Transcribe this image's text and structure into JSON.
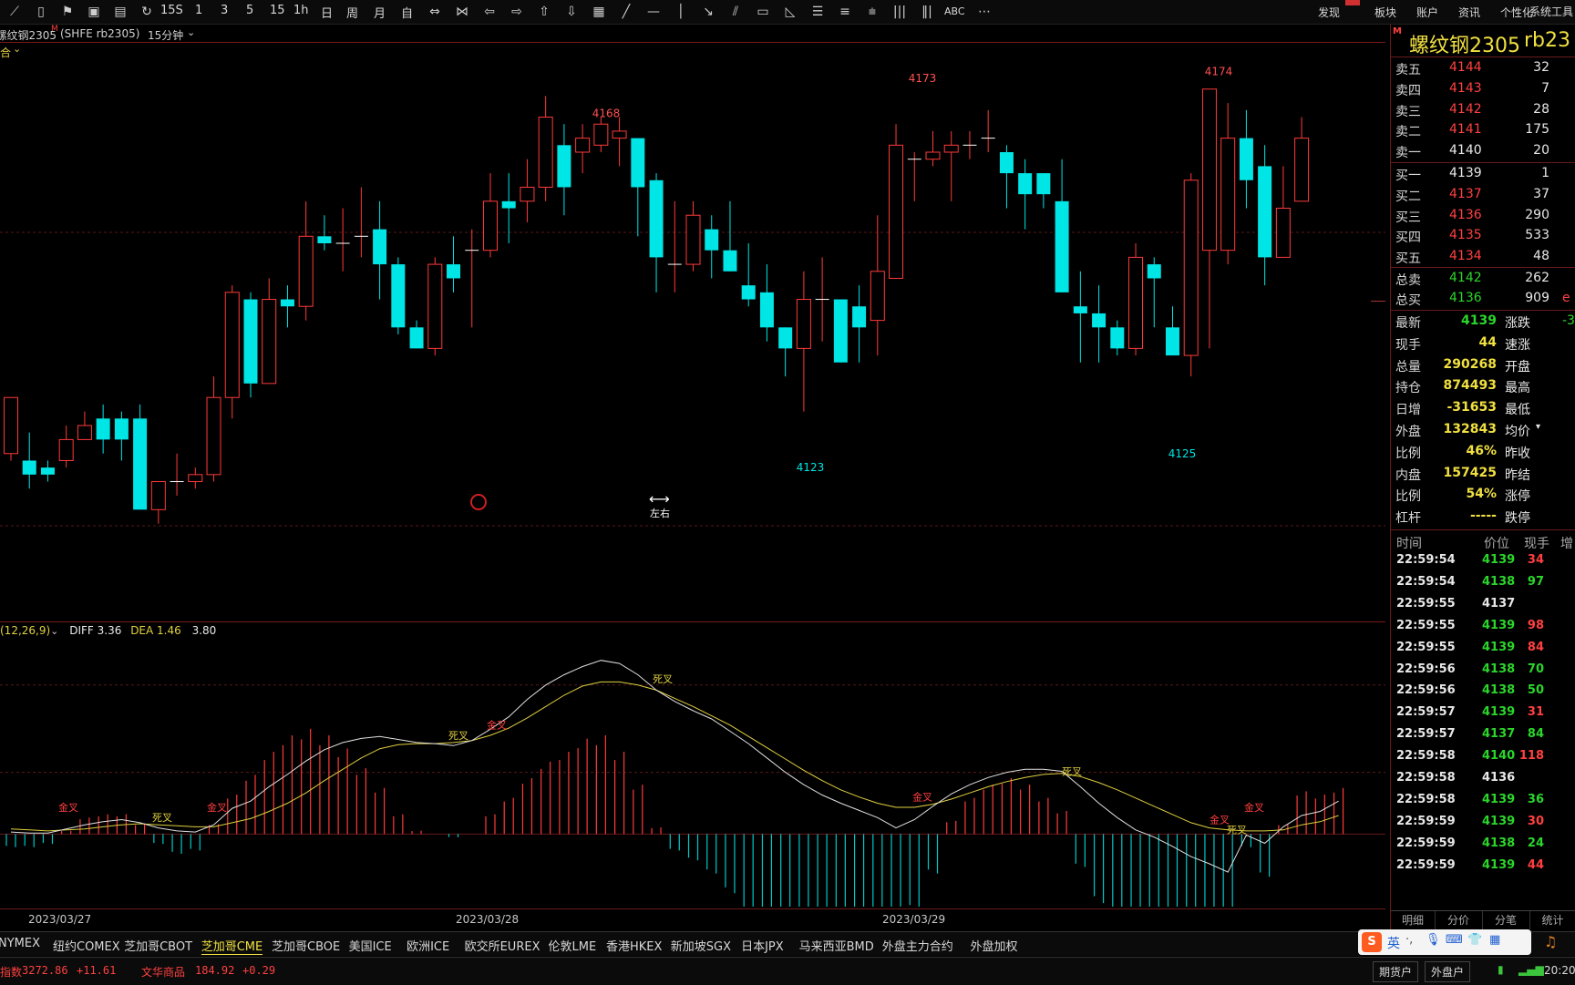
{
  "toolbar": {
    "period_buttons": [
      "15S",
      "1",
      "3",
      "5",
      "15",
      "1h",
      "日",
      "周",
      "月",
      "自"
    ],
    "abc": "ABC",
    "right_menu": [
      "发现",
      "板块",
      "账户",
      "资讯",
      "个性化",
      "系统工具"
    ]
  },
  "chart_header": {
    "title": "螺纹钢2305",
    "superscript": "M",
    "code": "(SHFE rb2305)",
    "period": "15分钟",
    "overlay_label": "合"
  },
  "chart_data": {
    "type": "candlestick",
    "ylim": [
      4100,
      4178
    ],
    "peak_labels": [
      {
        "text": "4168",
        "x": 665,
        "price": 4170.5,
        "color": "#ff5050"
      },
      {
        "text": "4173",
        "x": 1012,
        "price": 4175.5,
        "color": "#ff5050"
      },
      {
        "text": "4174",
        "x": 1337,
        "price": 4176.5,
        "color": "#ff5050"
      },
      {
        "text": "4123",
        "x": 889,
        "price": 4120.0,
        "color": "#00e5e5"
      },
      {
        "text": "4125",
        "x": 1297,
        "price": 4122.0,
        "color": "#00e5e5"
      }
    ],
    "candles": [
      [
        4122,
        4130,
        4121,
        4130
      ],
      [
        4121,
        4119,
        4125,
        4117
      ],
      [
        4120,
        4119,
        4121,
        4118
      ],
      [
        4121,
        4124,
        4120,
        4126
      ],
      [
        4124,
        4126,
        4124,
        4128
      ],
      [
        4127,
        4124,
        4122,
        4129
      ],
      [
        4127,
        4124,
        4121,
        4128
      ],
      [
        4127,
        4114,
        4114,
        4129
      ],
      [
        4114,
        4118,
        4112,
        4118
      ],
      [
        4118,
        4118,
        4116,
        4122
      ],
      [
        4118,
        4119,
        4117,
        4120
      ],
      [
        4119,
        4130,
        4118,
        4133
      ],
      [
        4130,
        4145,
        4127,
        4146
      ],
      [
        4144,
        4132,
        4130,
        4145
      ],
      [
        4132,
        4144,
        4132,
        4147
      ],
      [
        4144,
        4143,
        4140,
        4146
      ],
      [
        4143,
        4153,
        4141,
        4158
      ],
      [
        4153,
        4152,
        4151,
        4156
      ],
      [
        4152,
        4152,
        4148,
        4157
      ],
      [
        4153,
        4153,
        4150,
        4160
      ],
      [
        4154,
        4149,
        4144,
        4158
      ],
      [
        4149,
        4140,
        4139,
        4150
      ],
      [
        4140,
        4137,
        4137,
        4141
      ],
      [
        4137,
        4149,
        4136,
        4150
      ],
      [
        4149,
        4147,
        4145,
        4153
      ],
      [
        4151,
        4151,
        4140,
        4154
      ],
      [
        4151,
        4158,
        4150,
        4162
      ],
      [
        4158,
        4157,
        4152,
        4162
      ],
      [
        4158,
        4160,
        4155,
        4164
      ],
      [
        4160,
        4170,
        4158,
        4173
      ],
      [
        4166,
        4160,
        4156,
        4169
      ],
      [
        4165,
        4167,
        4162,
        4169
      ],
      [
        4166,
        4169,
        4165,
        4170
      ],
      [
        4167,
        4168,
        4163,
        4170
      ],
      [
        4167,
        4160,
        4153,
        4167
      ],
      [
        4161,
        4150,
        4145,
        4162
      ],
      [
        4149,
        4149,
        4145,
        4158
      ],
      [
        4149,
        4156,
        4148,
        4158
      ],
      [
        4154,
        4151,
        4147,
        4156
      ],
      [
        4151,
        4148,
        4148,
        4158
      ],
      [
        4146,
        4144,
        4143,
        4152
      ],
      [
        4145,
        4140,
        4138,
        4149
      ],
      [
        4140,
        4137,
        4133,
        4140
      ],
      [
        4137,
        4144,
        4128,
        4148
      ],
      [
        4144,
        4144,
        4138,
        4150
      ],
      [
        4144,
        4135,
        4135,
        4144
      ],
      [
        4143,
        4140,
        4135,
        4146
      ],
      [
        4141,
        4148,
        4136,
        4156
      ],
      [
        4147,
        4166,
        4164,
        4169
      ],
      [
        4164,
        4164,
        4158,
        4165
      ],
      [
        4164,
        4165,
        4163,
        4168
      ],
      [
        4165,
        4166,
        4158,
        4168
      ],
      [
        4166,
        4166,
        4164,
        4168
      ],
      [
        4167,
        4167,
        4165,
        4171
      ],
      [
        4165,
        4162,
        4157,
        4166
      ],
      [
        4162,
        4159,
        4154,
        4164
      ],
      [
        4162,
        4159,
        4157,
        4162
      ],
      [
        4158,
        4145,
        4145,
        4164
      ],
      [
        4143,
        4142,
        4135,
        4148
      ],
      [
        4142,
        4140,
        4135,
        4146
      ],
      [
        4140,
        4137,
        4136,
        4141
      ],
      [
        4137,
        4150,
        4136,
        4152
      ],
      [
        4149,
        4147,
        4140,
        4150
      ],
      [
        4140,
        4136,
        4136,
        4143
      ],
      [
        4136,
        4161,
        4133,
        4162
      ],
      [
        4151,
        4174,
        4137,
        4174
      ],
      [
        4151,
        4167,
        4149,
        4172
      ],
      [
        4167,
        4161,
        4157,
        4171
      ],
      [
        4163,
        4150,
        4146,
        4166
      ],
      [
        4150,
        4157,
        4150,
        4163
      ],
      [
        4158,
        4167,
        4159,
        4170
      ]
    ],
    "candle_colors": {
      "up": "#ff3a3a",
      "down": "#00e5e5"
    },
    "x_date_labels": [
      {
        "text": "2023/03/27",
        "x": 63
      },
      {
        "text": "2023/03/28",
        "x": 532
      },
      {
        "text": "2023/03/29",
        "x": 1000
      }
    ]
  },
  "macd": {
    "label": "(12,26,9)",
    "diff_label": "DIFF",
    "diff_value": "3.36",
    "dea_label": "DEA",
    "dea_value": "1.46",
    "macd_value": "3.80",
    "colors": {
      "diff": "#e0e0e0",
      "dea": "#e0d040"
    },
    "cross_labels": [
      {
        "text": "金叉",
        "kind": "gold",
        "x": 75,
        "val": 2
      },
      {
        "text": "死叉",
        "kind": "dead",
        "x": 178,
        "val": 1
      },
      {
        "text": "金叉",
        "kind": "gold",
        "x": 238,
        "val": 2
      },
      {
        "text": "死叉",
        "kind": "dead",
        "x": 503,
        "val": 9
      },
      {
        "text": "金叉",
        "kind": "gold",
        "x": 545,
        "val": 10
      },
      {
        "text": "死叉",
        "kind": "dead",
        "x": 727,
        "val": 14.5
      },
      {
        "text": "金叉",
        "kind": "gold",
        "x": 1012,
        "val": 3
      },
      {
        "text": "死叉",
        "kind": "dead",
        "x": 1176,
        "val": 5.5
      },
      {
        "text": "金叉",
        "kind": "gold",
        "x": 1338,
        "val": 0.8
      },
      {
        "text": "死叉",
        "kind": "dead",
        "x": 1357,
        "val": -0.2
      },
      {
        "text": "金叉",
        "kind": "gold",
        "x": 1376,
        "val": 2
      }
    ],
    "diff": [
      0.2,
      0.1,
      0.1,
      0.5,
      0.9,
      1.2,
      1.4,
      1.1,
      0.6,
      0.3,
      0.2,
      0.9,
      2.5,
      3.2,
      4.6,
      5.8,
      7.1,
      8.2,
      8.9,
      9.3,
      9.5,
      9.2,
      8.9,
      8.8,
      8.6,
      9.1,
      10.2,
      11.4,
      13.1,
      14.5,
      15.5,
      16.3,
      16.9,
      16.6,
      15.5,
      14.0,
      12.9,
      12.0,
      11.2,
      10.0,
      8.8,
      7.4,
      6.0,
      4.8,
      3.8,
      3.0,
      2.3,
      1.6,
      0.6,
      1.4,
      2.7,
      3.9,
      4.8,
      5.5,
      6.0,
      6.3,
      6.3,
      6.1,
      4.6,
      3.0,
      1.6,
      0.4,
      -0.3,
      -1.2,
      -2.2,
      -2.9,
      -3.7,
      -0.1,
      -0.9,
      0.7,
      1.8,
      2.2,
      3.2
    ],
    "dea": [
      0.5,
      0.4,
      0.3,
      0.4,
      0.5,
      0.7,
      0.9,
      1.0,
      0.9,
      0.8,
      0.7,
      0.7,
      1.1,
      1.5,
      2.2,
      3.0,
      4.0,
      5.2,
      6.3,
      7.4,
      8.3,
      8.7,
      8.8,
      8.8,
      8.9,
      9.1,
      9.6,
      10.3,
      11.3,
      12.4,
      13.5,
      14.4,
      14.8,
      14.8,
      14.5,
      14.0,
      13.2,
      12.4,
      11.5,
      10.6,
      9.5,
      8.4,
      7.3,
      6.2,
      5.2,
      4.3,
      3.6,
      3.0,
      2.6,
      2.6,
      2.9,
      3.4,
      4.0,
      4.6,
      5.1,
      5.5,
      5.8,
      5.9,
      5.6,
      5.0,
      4.3,
      3.5,
      2.7,
      1.9,
      1.1,
      0.6,
      0.4,
      0.3,
      0.3,
      0.4,
      0.9,
      1.2,
      1.8
    ],
    "hist_colors": {
      "pos": "#ff3a3a",
      "neg": "#00c8c8"
    },
    "hist": [
      -0.4,
      -0.4,
      -0.3,
      0.1,
      0.5,
      0.6,
      0.6,
      0.3,
      -0.3,
      -0.6,
      -0.5,
      0.3,
      1.2,
      1.8,
      2.5,
      3.0,
      3.2,
      3.0,
      2.6,
      2.0,
      1.4,
      0.6,
      0.1,
      0.0,
      -0.1,
      0.0,
      0.6,
      1.1,
      1.7,
      2.2,
      2.5,
      2.9,
      3.0,
      2.5,
      1.5,
      0.2,
      -0.5,
      -0.8,
      -1.2,
      -1.8,
      -2.6,
      -3.3,
      -3.9,
      -4.4,
      -4.8,
      -4.9,
      -4.8,
      -4.3,
      -3.4,
      -2.4,
      -1.2,
      0.4,
      1.1,
      1.5,
      1.7,
      1.5,
      1.1,
      0.7,
      -1.0,
      -2.1,
      -2.9,
      -3.3,
      -3.4,
      -3.2,
      -3.2,
      -3.5,
      -4.1,
      -0.4,
      -1.3,
      0.3,
      1.3,
      1.2,
      1.4
    ]
  },
  "quote_panel": {
    "title": "螺纹钢2305",
    "code": "rb23",
    "badge": "M",
    "asks": [
      {
        "label": "卖五",
        "price": "4144",
        "vol": "32"
      },
      {
        "label": "卖四",
        "price": "4143",
        "vol": "7"
      },
      {
        "label": "卖三",
        "price": "4142",
        "vol": "28"
      },
      {
        "label": "卖二",
        "price": "4141",
        "vol": "175"
      },
      {
        "label": "卖一",
        "price": "4140",
        "vol": "20"
      }
    ],
    "bids": [
      {
        "label": "买一",
        "price": "4139",
        "vol": "1"
      },
      {
        "label": "买二",
        "price": "4137",
        "vol": "37"
      },
      {
        "label": "买三",
        "price": "4136",
        "vol": "290"
      },
      {
        "label": "买四",
        "price": "4135",
        "vol": "533"
      },
      {
        "label": "买五",
        "price": "4134",
        "vol": "48"
      }
    ],
    "totals": [
      {
        "label": "总卖",
        "price": "4142",
        "vol": "262",
        "extra": ""
      },
      {
        "label": "总买",
        "price": "4136",
        "vol": "909",
        "extra": "e"
      }
    ],
    "stats": [
      {
        "label": "最新",
        "value": "4139",
        "color": "green",
        "label2": "涨跌",
        "value2": "-3"
      },
      {
        "label": "现手",
        "value": "44",
        "color": "yellow",
        "label2": "速涨",
        "value2": ""
      },
      {
        "label": "总量",
        "value": "290268",
        "color": "yellow",
        "label2": "开盘",
        "value2": ""
      },
      {
        "label": "持仓",
        "value": "874493",
        "color": "yellow",
        "label2": "最高",
        "value2": ""
      },
      {
        "label": "日增",
        "value": "-31653",
        "color": "yellow",
        "label2": "最低",
        "value2": ""
      },
      {
        "label": "外盘",
        "value": "132843",
        "color": "yellow",
        "label2": "均价",
        "value2": ""
      },
      {
        "label": "比例",
        "value": "46%",
        "color": "yellow",
        "label2": "昨收",
        "value2": ""
      },
      {
        "label": "内盘",
        "value": "157425",
        "color": "yellow",
        "label2": "昨结",
        "value2": ""
      },
      {
        "label": "比例",
        "value": "54%",
        "color": "yellow",
        "label2": "涨停",
        "value2": ""
      },
      {
        "label": "杠杆",
        "value": "-----",
        "color": "yellow",
        "label2": "跌停",
        "value2": ""
      }
    ],
    "ticks_header": {
      "time": "时间",
      "price": "价位",
      "vol": "现手",
      "add": "增"
    },
    "ticks": [
      {
        "time": "22:59:54",
        "price": "4139",
        "pc": "green",
        "vol": "34",
        "vc": "red"
      },
      {
        "time": "22:59:54",
        "price": "4138",
        "pc": "green",
        "vol": "97",
        "vc": "green"
      },
      {
        "time": "22:59:55",
        "price": "4137",
        "pc": "white",
        "vol": "",
        "vc": "white"
      },
      {
        "time": "22:59:55",
        "price": "4139",
        "pc": "green",
        "vol": "98",
        "vc": "red"
      },
      {
        "time": "22:59:55",
        "price": "4139",
        "pc": "green",
        "vol": "84",
        "vc": "red"
      },
      {
        "time": "22:59:56",
        "price": "4138",
        "pc": "green",
        "vol": "70",
        "vc": "green"
      },
      {
        "time": "22:59:56",
        "price": "4138",
        "pc": "green",
        "vol": "50",
        "vc": "green"
      },
      {
        "time": "22:59:57",
        "price": "4139",
        "pc": "green",
        "vol": "31",
        "vc": "red"
      },
      {
        "time": "22:59:57",
        "price": "4137",
        "pc": "green",
        "vol": "84",
        "vc": "green"
      },
      {
        "time": "22:59:58",
        "price": "4140",
        "pc": "green",
        "vol": "118",
        "vc": "red"
      },
      {
        "time": "22:59:58",
        "price": "4136",
        "pc": "white",
        "vol": "",
        "vc": "white"
      },
      {
        "time": "22:59:58",
        "price": "4139",
        "pc": "green",
        "vol": "36",
        "vc": "green"
      },
      {
        "time": "22:59:59",
        "price": "4139",
        "pc": "green",
        "vol": "30",
        "vc": "red"
      },
      {
        "time": "22:59:59",
        "price": "4138",
        "pc": "green",
        "vol": "24",
        "vc": "green"
      },
      {
        "time": "22:59:59",
        "price": "4139",
        "pc": "green",
        "vol": "44",
        "vc": "red"
      }
    ],
    "tabs": [
      "明细",
      "分价",
      "分笔",
      "统计"
    ]
  },
  "cursor_hint": "左右",
  "exchanges": [
    "NYMEX",
    "纽约COMEX",
    "芝加哥CBOT",
    "芝加哥CME",
    "芝加哥CBOE",
    "美国ICE",
    "欧洲ICE",
    "欧交所EUREX",
    "伦敦LME",
    "香港HKEX",
    "新加坡SGX",
    "日本JPX",
    "马来西亚BMD",
    "外盘主力合约",
    "外盘加权"
  ],
  "exchange_active": "芝加哥CME",
  "status": {
    "index_label": "指数",
    "index_value": "3272.86",
    "index_change": "+11.61",
    "wh_label": "文华商品",
    "wh_value": "184.92",
    "wh_change": "+0.29",
    "btn1": "期货户",
    "btn2": "外盘户",
    "clock": "20:20",
    "ime": "英"
  }
}
